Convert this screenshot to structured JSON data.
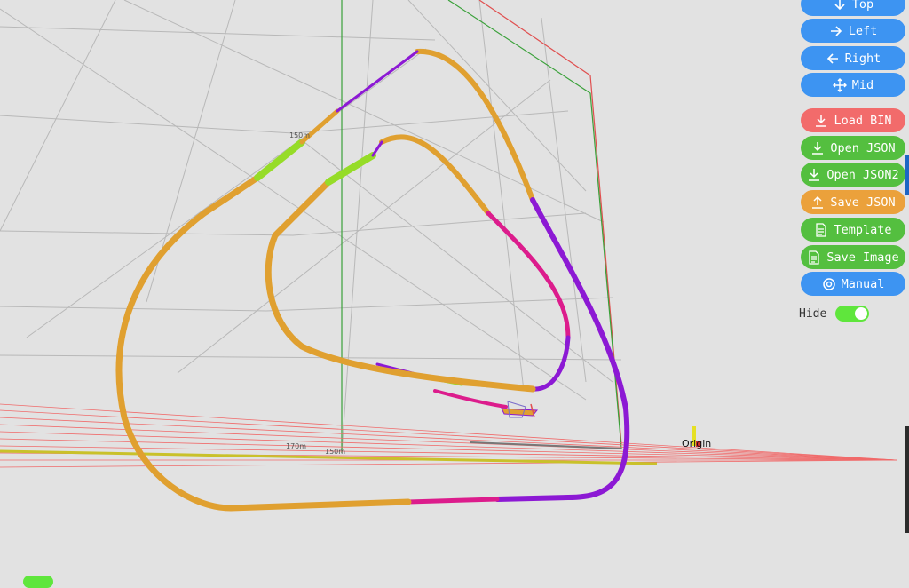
{
  "toolbar": {
    "buttons": [
      {
        "label": "Top",
        "icon": "arrow-down-icon"
      },
      {
        "label": "Left",
        "icon": "arrow-right-icon"
      },
      {
        "label": "Right",
        "icon": "arrow-left-icon"
      },
      {
        "label": "Mid",
        "icon": "move-icon"
      },
      {
        "label": "Load BIN",
        "icon": "download-icon"
      },
      {
        "label": "Open JSON",
        "icon": "download-icon"
      },
      {
        "label": "Open JSON2",
        "icon": "download-icon"
      },
      {
        "label": "Save JSON",
        "icon": "upload-icon"
      },
      {
        "label": "Template",
        "icon": "document-icon"
      },
      {
        "label": "Save Image",
        "icon": "document-icon"
      },
      {
        "label": "Manual",
        "icon": "lifebuoy-icon"
      }
    ],
    "hide_label": "Hide",
    "hide_on": true
  },
  "scene": {
    "distance_labels": [
      "150m",
      "170m",
      "150m"
    ],
    "origin_label": "Origin"
  },
  "colors": {
    "blue": "#3d94f2",
    "red": "#f26b6b",
    "green": "#54bf3f",
    "orange": "#eba13b",
    "trail_orange": "#e0a030",
    "trail_purple": "#8c19d4",
    "trail_magenta": "#dc1c8c",
    "trail_green": "#96dc28"
  }
}
